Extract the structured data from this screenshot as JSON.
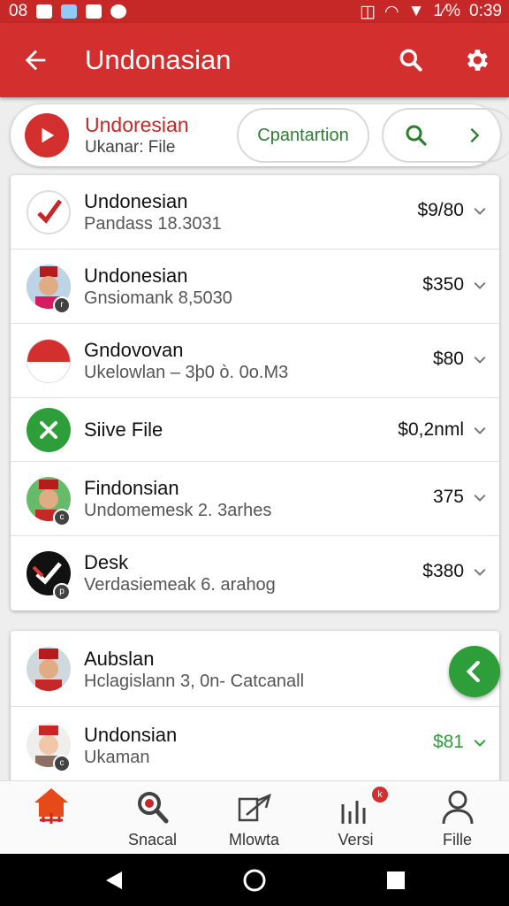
{
  "status_bar": {
    "time_left": "08",
    "battery": "1⁄%",
    "time_right": "0:39"
  },
  "app_bar": {
    "title": "Undonasian"
  },
  "top_card": {
    "title": "Undoresian",
    "subtitle": "Ukanar: File",
    "pill_label": "Cpantartion"
  },
  "list1": [
    {
      "title": "Undonesian",
      "subtitle": "Pandass 18.3031",
      "amount": "$9/80",
      "avatar": "check-logo"
    },
    {
      "title": "Undonesian",
      "subtitle": "Gnsiomank 8,5030",
      "amount": "$350",
      "avatar": "person-red-hat"
    },
    {
      "title": "Gndovovan",
      "subtitle": "Ukelowlan – 3þ0 ò. 0o.M3",
      "amount": "$80",
      "avatar": "flag-indonesia"
    },
    {
      "title": "Siive File",
      "subtitle": "",
      "amount": "$0,2nml",
      "avatar": "green-x"
    },
    {
      "title": "Findonsian",
      "subtitle": "Undomemesk 2. 3arhes",
      "amount": "375",
      "avatar": "person-green"
    },
    {
      "title": "Desk",
      "subtitle": "Verdasiemeak 6. arahog",
      "amount": "$380",
      "avatar": "black-check-logo"
    }
  ],
  "list2": [
    {
      "title": "Aubslan",
      "subtitle": "Hclagislann 3, 0n- Catcanall",
      "amount": "",
      "avatar": "person-red-hat"
    },
    {
      "title": "Undonsian",
      "subtitle": "Ukaman",
      "amount": "$81",
      "avatar": "person-sketch"
    }
  ],
  "bottom_nav": [
    {
      "label": "",
      "icon": "home-icon"
    },
    {
      "label": "Snacal",
      "icon": "search-icon"
    },
    {
      "label": "Mlowta",
      "icon": "share-icon"
    },
    {
      "label": "Versi",
      "icon": "chart-icon",
      "badge": "k"
    },
    {
      "label": "Fille",
      "icon": "person-icon"
    }
  ],
  "colors": {
    "primary": "#d32f2f",
    "green": "#2e7d32",
    "fab": "#2e9e3a"
  }
}
